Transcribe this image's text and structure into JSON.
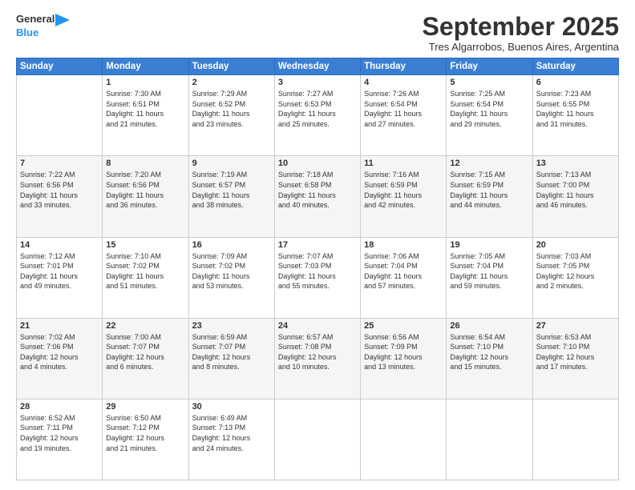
{
  "logo": {
    "line1": "General",
    "line2": "Blue"
  },
  "title": "September 2025",
  "subtitle": "Tres Algarrobos, Buenos Aires, Argentina",
  "headers": [
    "Sunday",
    "Monday",
    "Tuesday",
    "Wednesday",
    "Thursday",
    "Friday",
    "Saturday"
  ],
  "weeks": [
    [
      {
        "day": "",
        "info": ""
      },
      {
        "day": "1",
        "info": "Sunrise: 7:30 AM\nSunset: 6:51 PM\nDaylight: 11 hours\nand 21 minutes."
      },
      {
        "day": "2",
        "info": "Sunrise: 7:29 AM\nSunset: 6:52 PM\nDaylight: 11 hours\nand 23 minutes."
      },
      {
        "day": "3",
        "info": "Sunrise: 7:27 AM\nSunset: 6:53 PM\nDaylight: 11 hours\nand 25 minutes."
      },
      {
        "day": "4",
        "info": "Sunrise: 7:26 AM\nSunset: 6:54 PM\nDaylight: 11 hours\nand 27 minutes."
      },
      {
        "day": "5",
        "info": "Sunrise: 7:25 AM\nSunset: 6:54 PM\nDaylight: 11 hours\nand 29 minutes."
      },
      {
        "day": "6",
        "info": "Sunrise: 7:23 AM\nSunset: 6:55 PM\nDaylight: 11 hours\nand 31 minutes."
      }
    ],
    [
      {
        "day": "7",
        "info": "Sunrise: 7:22 AM\nSunset: 6:56 PM\nDaylight: 11 hours\nand 33 minutes."
      },
      {
        "day": "8",
        "info": "Sunrise: 7:20 AM\nSunset: 6:56 PM\nDaylight: 11 hours\nand 36 minutes."
      },
      {
        "day": "9",
        "info": "Sunrise: 7:19 AM\nSunset: 6:57 PM\nDaylight: 11 hours\nand 38 minutes."
      },
      {
        "day": "10",
        "info": "Sunrise: 7:18 AM\nSunset: 6:58 PM\nDaylight: 11 hours\nand 40 minutes."
      },
      {
        "day": "11",
        "info": "Sunrise: 7:16 AM\nSunset: 6:59 PM\nDaylight: 11 hours\nand 42 minutes."
      },
      {
        "day": "12",
        "info": "Sunrise: 7:15 AM\nSunset: 6:59 PM\nDaylight: 11 hours\nand 44 minutes."
      },
      {
        "day": "13",
        "info": "Sunrise: 7:13 AM\nSunset: 7:00 PM\nDaylight: 11 hours\nand 46 minutes."
      }
    ],
    [
      {
        "day": "14",
        "info": "Sunrise: 7:12 AM\nSunset: 7:01 PM\nDaylight: 11 hours\nand 49 minutes."
      },
      {
        "day": "15",
        "info": "Sunrise: 7:10 AM\nSunset: 7:02 PM\nDaylight: 11 hours\nand 51 minutes."
      },
      {
        "day": "16",
        "info": "Sunrise: 7:09 AM\nSunset: 7:02 PM\nDaylight: 11 hours\nand 53 minutes."
      },
      {
        "day": "17",
        "info": "Sunrise: 7:07 AM\nSunset: 7:03 PM\nDaylight: 11 hours\nand 55 minutes."
      },
      {
        "day": "18",
        "info": "Sunrise: 7:06 AM\nSunset: 7:04 PM\nDaylight: 11 hours\nand 57 minutes."
      },
      {
        "day": "19",
        "info": "Sunrise: 7:05 AM\nSunset: 7:04 PM\nDaylight: 11 hours\nand 59 minutes."
      },
      {
        "day": "20",
        "info": "Sunrise: 7:03 AM\nSunset: 7:05 PM\nDaylight: 12 hours\nand 2 minutes."
      }
    ],
    [
      {
        "day": "21",
        "info": "Sunrise: 7:02 AM\nSunset: 7:06 PM\nDaylight: 12 hours\nand 4 minutes."
      },
      {
        "day": "22",
        "info": "Sunrise: 7:00 AM\nSunset: 7:07 PM\nDaylight: 12 hours\nand 6 minutes."
      },
      {
        "day": "23",
        "info": "Sunrise: 6:59 AM\nSunset: 7:07 PM\nDaylight: 12 hours\nand 8 minutes."
      },
      {
        "day": "24",
        "info": "Sunrise: 6:57 AM\nSunset: 7:08 PM\nDaylight: 12 hours\nand 10 minutes."
      },
      {
        "day": "25",
        "info": "Sunrise: 6:56 AM\nSunset: 7:09 PM\nDaylight: 12 hours\nand 13 minutes."
      },
      {
        "day": "26",
        "info": "Sunrise: 6:54 AM\nSunset: 7:10 PM\nDaylight: 12 hours\nand 15 minutes."
      },
      {
        "day": "27",
        "info": "Sunrise: 6:53 AM\nSunset: 7:10 PM\nDaylight: 12 hours\nand 17 minutes."
      }
    ],
    [
      {
        "day": "28",
        "info": "Sunrise: 6:52 AM\nSunset: 7:11 PM\nDaylight: 12 hours\nand 19 minutes."
      },
      {
        "day": "29",
        "info": "Sunrise: 6:50 AM\nSunset: 7:12 PM\nDaylight: 12 hours\nand 21 minutes."
      },
      {
        "day": "30",
        "info": "Sunrise: 6:49 AM\nSunset: 7:13 PM\nDaylight: 12 hours\nand 24 minutes."
      },
      {
        "day": "",
        "info": ""
      },
      {
        "day": "",
        "info": ""
      },
      {
        "day": "",
        "info": ""
      },
      {
        "day": "",
        "info": ""
      }
    ]
  ]
}
